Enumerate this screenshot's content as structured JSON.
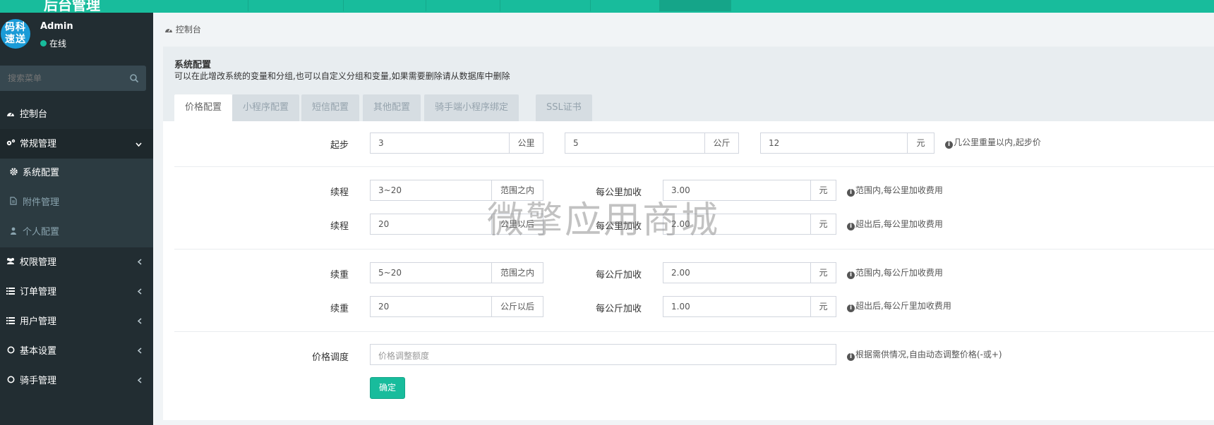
{
  "header": {
    "brand_fragment": "后台管理"
  },
  "sidebar": {
    "avatar_text": [
      "码科",
      "速送"
    ],
    "username": "Admin",
    "status": "在线",
    "search_placeholder": "搜索菜单",
    "menu": [
      {
        "label": "控制台",
        "icon": "dashboard-icon"
      },
      {
        "label": "常规管理",
        "icon": "cogs-icon",
        "open": true
      },
      {
        "label": "权限管理",
        "icon": "group-icon"
      },
      {
        "label": "订单管理",
        "icon": "list-icon"
      },
      {
        "label": "用户管理",
        "icon": "list-icon"
      },
      {
        "label": "基本设置",
        "icon": "circle-icon"
      },
      {
        "label": "骑手管理",
        "icon": "circle-icon"
      }
    ],
    "submenu": [
      {
        "label": "系统配置",
        "icon": "gear-icon"
      },
      {
        "label": "附件管理",
        "icon": "file-icon"
      },
      {
        "label": "个人配置",
        "icon": "user-icon"
      }
    ]
  },
  "breadcrumb": {
    "label": "控制台"
  },
  "panel": {
    "title": "系统配置",
    "description": "可以在此增改系统的变量和分组,也可以自定义分组和变量,如果需要删除请从数据库中删除",
    "tabs": [
      "价格配置",
      "小程序配置",
      "短信配置",
      "其他配置",
      "骑手端小程序绑定",
      "SSL证书"
    ]
  },
  "form": {
    "start": {
      "label": "起步",
      "distance": "3",
      "distance_unit": "公里",
      "weight": "5",
      "weight_unit": "公斤",
      "price": "12",
      "price_unit": "元",
      "hint": "几公里重量以内,起步价"
    },
    "distance_range": {
      "label": "续程",
      "value": "3~20",
      "unit": "范围之内",
      "fee_label": "每公里加收",
      "fee": "3.00",
      "fee_unit": "元",
      "hint": "范围内,每公里加收费用"
    },
    "distance_over": {
      "label": "续程",
      "value": "20",
      "unit": "公里以后",
      "fee_label": "每公里加收",
      "fee": "2.00",
      "fee_unit": "元",
      "hint": "超出后,每公里加收费用"
    },
    "weight_range": {
      "label": "续重",
      "value": "5~20",
      "unit": "范围之内",
      "fee_label": "每公斤加收",
      "fee": "2.00",
      "fee_unit": "元",
      "hint": "范围内,每公斤加收费用"
    },
    "weight_over": {
      "label": "续重",
      "value": "20",
      "unit": "公斤以后",
      "fee_label": "每公斤加收",
      "fee": "1.00",
      "fee_unit": "元",
      "hint": "超出后,每公斤里加收费用"
    },
    "adjust": {
      "label": "价格调度",
      "placeholder": "价格调整额度",
      "hint": "根据需供情况,自由动态调整价格(-或+)"
    },
    "submit_label": "确定"
  },
  "watermark": "微擎应用商城",
  "colors": {
    "accent": "#18bc9c",
    "sidebar_bg": "#222d32"
  }
}
